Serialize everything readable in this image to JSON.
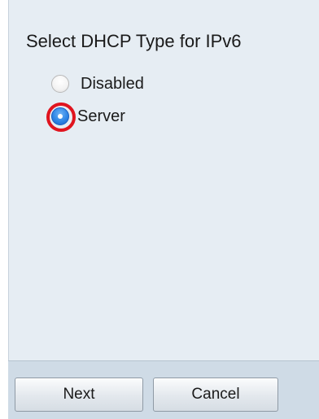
{
  "dhcp_section": {
    "title": "Select DHCP Type for IPv6",
    "options": [
      {
        "label": "Disabled",
        "selected": false
      },
      {
        "label": "Server",
        "selected": true
      }
    ]
  },
  "buttons": {
    "next_label": "Next",
    "cancel_label": "Cancel"
  },
  "colors": {
    "panel_background": "#e6edf3",
    "footer_background": "#cfdbe6",
    "selected_radio": "#2f86e6",
    "highlight_ring": "#e0141e"
  }
}
